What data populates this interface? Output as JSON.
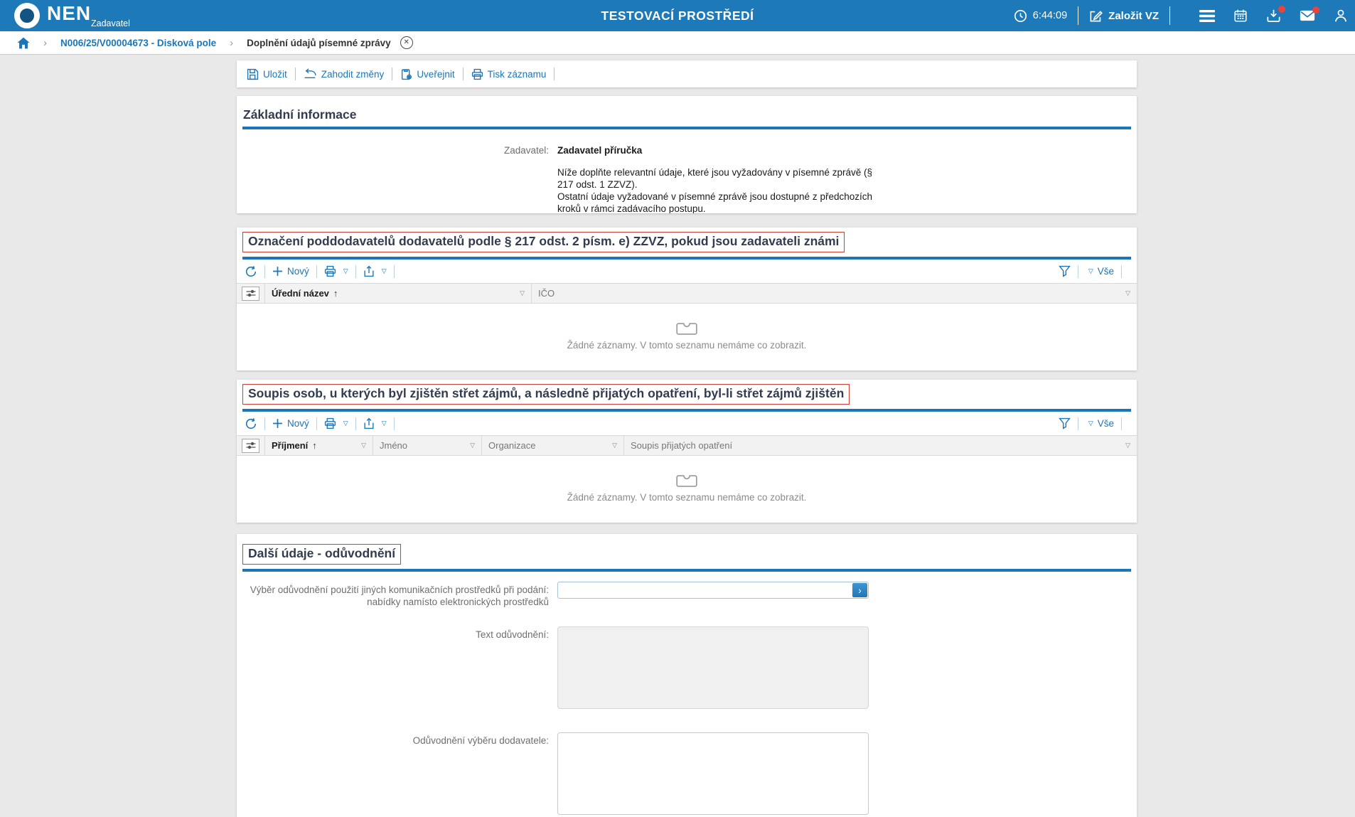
{
  "header": {
    "logo": "NEN",
    "logo_subtitle": "Zadavatel",
    "environment_title": "TESTOVACÍ PROSTŘEDÍ",
    "time": "6:44:09",
    "create_vz_label": "Založit VZ"
  },
  "breadcrumb": {
    "item1": "N006/25/V00004673 - Disková pole",
    "item2": "Doplnění údajů písemné zprávy"
  },
  "actions": {
    "save": "Uložit",
    "discard": "Zahodit změny",
    "publish": "Uveřejnit",
    "print": "Tisk záznamu"
  },
  "basic_info": {
    "title": "Základní informace",
    "contracting_authority_label": "Zadavatel:",
    "contracting_authority_value": "Zadavatel příručka",
    "note_paragraph1": "Níže doplňte relevantní údaje, které jsou vyžadovány v písemné zprávě (§ 217 odst. 1 ZZVZ).",
    "note_paragraph2": "Ostatní údaje vyžadované v písemné zprávě jsou dostupné z předchozích kroků v rámci zadávacího postupu."
  },
  "subcontractors_section": {
    "title": "Označení poddodavatelů dodavatelů podle § 217 odst. 2 písm. e) ZZVZ, pokud jsou zadavateli známi",
    "new_label": "Nový",
    "filter_all_label": "Vše",
    "columns": [
      "Úřední název",
      "IČO"
    ],
    "empty_message": "Žádné záznamy. V tomto seznamu nemáme co zobrazit."
  },
  "conflict_section": {
    "title": "Soupis osob, u kterých byl zjištěn střet zájmů, a následně přijatých opatření, byl-li střet zájmů zjištěn",
    "new_label": "Nový",
    "filter_all_label": "Vše",
    "columns": [
      "Příjmení",
      "Jméno",
      "Organizace",
      "Soupis přijatých opatření"
    ],
    "empty_message": "Žádné záznamy. V tomto seznamu nemáme co zobrazit."
  },
  "additional_section": {
    "title": "Další údaje - odůvodnění",
    "communication_label_line1": "Výběr odůvodnění použití jiných komunikačních prostředků při podání:",
    "communication_label_line2": "nabídky namísto elektronických prostředků",
    "communication_value": "",
    "justification_text_label": "Text odůvodnění:",
    "justification_text_value": "",
    "supplier_selection_label": "Odůvodnění výběru dodavatele:",
    "supplier_selection_value": ""
  },
  "icons": {
    "sort_asc": "↑",
    "dropdown_triangle": "▽",
    "chevron_right": "›",
    "close": "✕"
  },
  "colors": {
    "topbar": "#1d79b7",
    "accent_blue": "#1b76b8",
    "red_outline": "#cf3c34",
    "badge_red": "#e8443b"
  }
}
